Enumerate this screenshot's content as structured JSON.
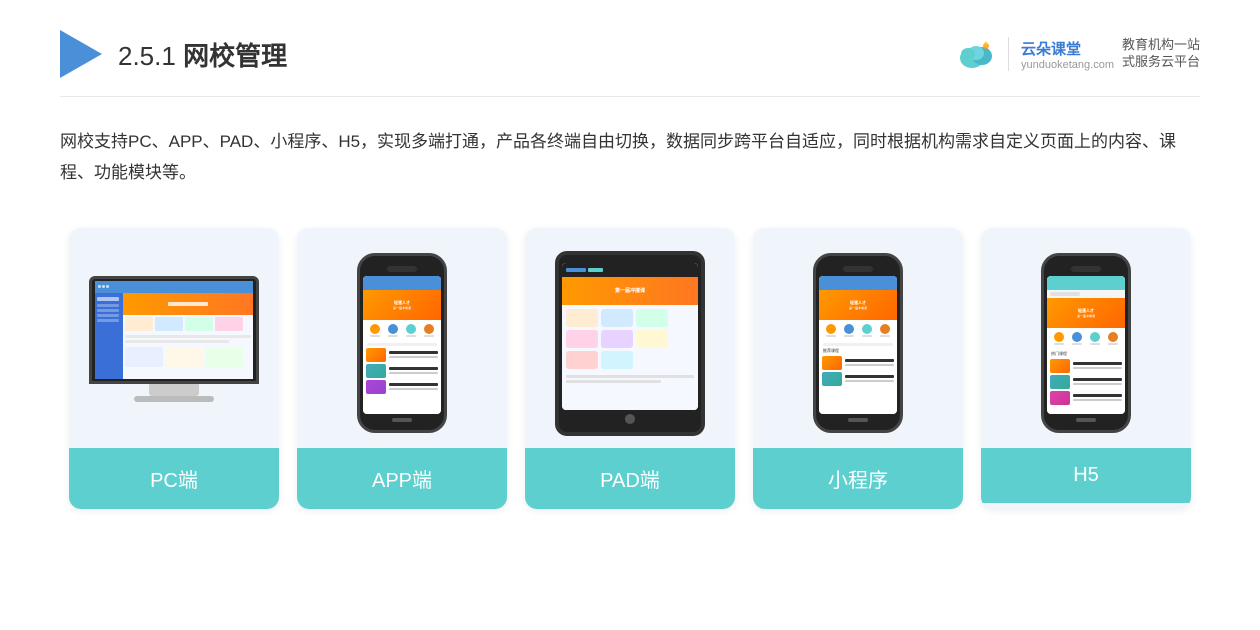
{
  "header": {
    "section_number": "2.5.1",
    "title_plain": "2.5.1 ",
    "title_bold": "网校管理",
    "logo_name": "云朵课堂",
    "logo_url": "yunduoketang.com",
    "logo_tagline1": "教育机构一站",
    "logo_tagline2": "式服务云平台"
  },
  "description": {
    "text": "网校支持PC、APP、PAD、小程序、H5，实现多端打通，产品各终端自由切换，数据同步跨平台自适应，同时根据机构需求自定义页面上的内容、课程、功能模块等。"
  },
  "cards": [
    {
      "id": "pc",
      "label": "PC端"
    },
    {
      "id": "app",
      "label": "APP端"
    },
    {
      "id": "pad",
      "label": "PAD端"
    },
    {
      "id": "miniapp",
      "label": "小程序"
    },
    {
      "id": "h5",
      "label": "H5"
    }
  ],
  "colors": {
    "accent_blue": "#4A90D9",
    "card_bg": "#eef4fb",
    "card_label_bg": "#5ecfcf",
    "triangle_color": "#4A90D9"
  }
}
